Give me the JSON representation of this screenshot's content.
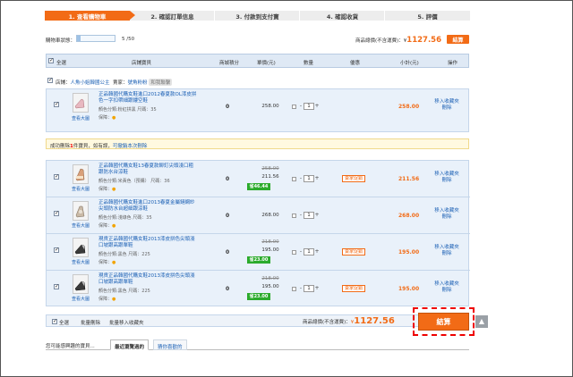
{
  "steps": [
    {
      "label": "1. 查看購物車",
      "active": true
    },
    {
      "label": "2. 確認訂單信息",
      "active": false
    },
    {
      "label": "3. 付款到支付寶",
      "active": false
    },
    {
      "label": "4. 確認收貨",
      "active": false
    },
    {
      "label": "5. 評價",
      "active": false
    }
  ],
  "cart_status": {
    "label": "購物車狀態：",
    "count": "5 /50",
    "fill_fraction": 0.1
  },
  "total_top": {
    "label": "商品總價(不含運費)：¥",
    "amount": "1127.56",
    "button": "結算"
  },
  "header": {
    "select_all": "全選",
    "item": "店鋪寶貝",
    "points": "商城積分",
    "unit_price": "單價(元)",
    "quantity": "數量",
    "promo": "優惠",
    "subtotal": "小計(元)",
    "ops": "操作"
  },
  "shop": {
    "label": "店鋪：",
    "name": "人魚小姐韓國公主",
    "seller_label": "賣家：",
    "seller": "號角粉粉",
    "chat": "和我聯繫"
  },
  "group1": [
    {
      "title": "正品韓國代購女鞋進口2012春夏款OL漆皮拼色一字扣帶細跟鏤空鞋",
      "meta": "顏色分類:粉紅拼黑   尺碼：35",
      "guarantee": "保障：",
      "view": "查看大圖",
      "points": "0",
      "price": "258.00",
      "qty": "1",
      "subtotal": "258.00",
      "ops": [
        "移入收藏夾",
        "刪除"
      ]
    }
  ],
  "notice": {
    "text": "成功刪除",
    "count": "1",
    "unit": "件寶貝，",
    "undo_prompt": "如有誤，",
    "undo": "可撤銷本次刪除"
  },
  "group2": [
    {
      "title": "正品韓國代購女鞋13春夏款鉚釘尖頭淺口粗跟防水台涼鞋",
      "meta": "顏色分類:米黃色（預購）   尺碼：36",
      "guarantee": "保障：",
      "view": "查看大圖",
      "points": "0",
      "orig_price": "258.00",
      "price": "211.56",
      "save": "省46.44",
      "qty": "1",
      "promo": "賣家促銷",
      "subtotal": "211.56",
      "ops": [
        "移入收藏夾",
        "刪除"
      ]
    },
    {
      "title": "正品韓國代購女鞋進口2013春夏金屬鏈網紗尖頭防水台超細跟涼鞋",
      "meta": "顏色分類:淺綠色   尺碼：35",
      "guarantee": "保障：",
      "view": "查看大圖",
      "points": "0",
      "price": "268.00",
      "qty": "1",
      "subtotal": "268.00",
      "ops": [
        "移入收藏夾",
        "刪除"
      ]
    },
    {
      "title": "現貨正品韓國代購女鞋2013漆皮拼色尖頭淺口坡跟高跟單鞋",
      "meta": "顏色分類:黑色   尺碼：225",
      "guarantee": "保障：",
      "view": "查看大圖",
      "points": "0",
      "orig_price": "218.00",
      "price": "195.00",
      "save": "省23.00",
      "qty": "1",
      "promo": "賣家促銷",
      "subtotal": "195.00",
      "ops": [
        "移入收藏夾",
        "刪除"
      ]
    },
    {
      "title": "現貨正品韓國代購女鞋2013漆皮拼色尖頭淺口坡跟高跟單鞋",
      "meta": "顏色分類:黑色   尺碼：225",
      "guarantee": "保障：",
      "view": "查看大圖",
      "points": "0",
      "orig_price": "218.00",
      "price": "195.00",
      "save": "省23.00",
      "qty": "1",
      "promo": "賣家促銷",
      "subtotal": "195.00",
      "ops": [
        "移入收藏夾",
        "刪除"
      ]
    }
  ],
  "footer": {
    "select_all": "全選",
    "batch_delete": "批量刪除",
    "batch_fav": "批量移入收藏夾"
  },
  "total_bottom": {
    "label": "商品總價(不含運費)：",
    "currency": "¥",
    "amount": "1127.56",
    "button": "結算"
  },
  "bottom_tabs": {
    "prompt": "您可能感興趣的寶貝...",
    "tab1": "最近瀏覽過的",
    "tab2": "猜你喜歡的"
  },
  "colors": {
    "accent": "#f26b16",
    "save_green": "#2cab2c",
    "link": "#1a5fb4",
    "highlight": "#e00000"
  }
}
